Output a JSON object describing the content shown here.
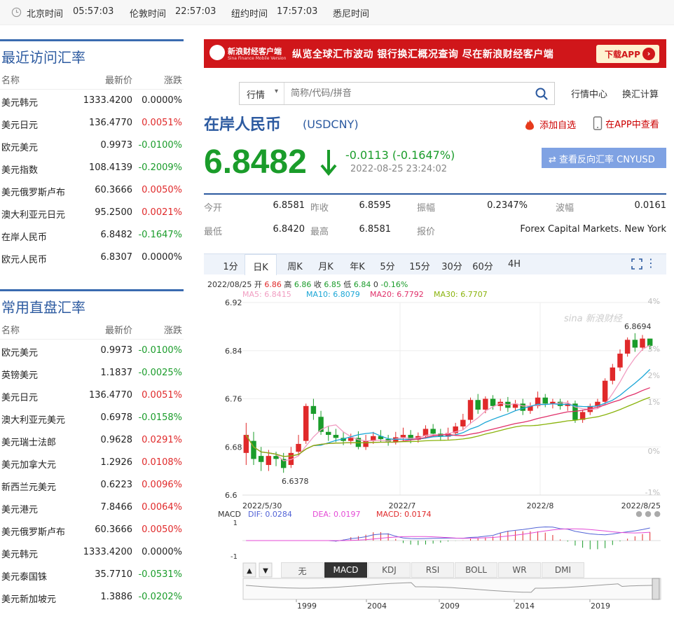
{
  "topbar": {
    "times": [
      {
        "city": "北京时间",
        "time": "05:57:03"
      },
      {
        "city": "伦敦时间",
        "time": "22:57:03"
      },
      {
        "city": "纽约时间",
        "time": "17:57:03"
      },
      {
        "city": "悉尼时间",
        "time": ""
      }
    ]
  },
  "recent": {
    "title": "最近访问汇率",
    "headers": {
      "name": "名称",
      "price": "最新价",
      "change": "涨跌"
    },
    "rows": [
      {
        "name": "美元韩元",
        "price": "1333.4200",
        "change": "0.0000%",
        "dir": "flat"
      },
      {
        "name": "美元日元",
        "price": "136.4770",
        "change": "0.0051%",
        "dir": "up"
      },
      {
        "name": "欧元美元",
        "price": "0.9973",
        "change": "-0.0100%",
        "dir": "down"
      },
      {
        "name": "美元指数",
        "price": "108.4139",
        "change": "-0.2009%",
        "dir": "down"
      },
      {
        "name": "美元俄罗斯卢布",
        "price": "60.3666",
        "change": "0.0050%",
        "dir": "up"
      },
      {
        "name": "澳大利亚元日元",
        "price": "95.2500",
        "change": "0.0021%",
        "dir": "up"
      },
      {
        "name": "在岸人民币",
        "price": "6.8482",
        "change": "-0.1647%",
        "dir": "down"
      },
      {
        "name": "欧元人民币",
        "price": "6.8307",
        "change": "0.0000%",
        "dir": "flat"
      }
    ]
  },
  "direct": {
    "title": "常用直盘汇率",
    "headers": {
      "name": "名称",
      "price": "最新价",
      "change": "涨跌"
    },
    "rows": [
      {
        "name": "欧元美元",
        "price": "0.9973",
        "change": "-0.0100%",
        "dir": "down"
      },
      {
        "name": "英镑美元",
        "price": "1.1837",
        "change": "-0.0025%",
        "dir": "down"
      },
      {
        "name": "美元日元",
        "price": "136.4770",
        "change": "0.0051%",
        "dir": "up"
      },
      {
        "name": "澳大利亚元美元",
        "price": "0.6978",
        "change": "-0.0158%",
        "dir": "down"
      },
      {
        "name": "美元瑞士法郎",
        "price": "0.9628",
        "change": "0.0291%",
        "dir": "up"
      },
      {
        "name": "美元加拿大元",
        "price": "1.2926",
        "change": "0.0108%",
        "dir": "up"
      },
      {
        "name": "新西兰元美元",
        "price": "0.6223",
        "change": "0.0096%",
        "dir": "up"
      },
      {
        "name": "美元港元",
        "price": "7.8466",
        "change": "0.0064%",
        "dir": "up"
      },
      {
        "name": "美元俄罗斯卢布",
        "price": "60.3666",
        "change": "0.0050%",
        "dir": "up"
      },
      {
        "name": "美元韩元",
        "price": "1333.4200",
        "change": "0.0000%",
        "dir": "flat"
      },
      {
        "name": "美元泰国铢",
        "price": "35.7710",
        "change": "-0.0531%",
        "dir": "down"
      },
      {
        "name": "美元新加坡元",
        "price": "1.3886",
        "change": "-0.0202%",
        "dir": "down"
      }
    ]
  },
  "banner": {
    "logo_title": "新浪财经客户端",
    "logo_sub": "Sina Finance Mobile Version",
    "slogan": "纵览全球汇市波动  银行换汇概况查询  尽在新浪财经客户端",
    "download": "下载APP"
  },
  "search": {
    "dropdown": "行情",
    "placeholder": "简称/代码/拼音",
    "link1": "行情中心",
    "link2": "换汇计算"
  },
  "quote": {
    "name": "在岸人民币",
    "code": "(USDCNY)",
    "add_fav": "添加自选",
    "app_view": "在APP中查看",
    "price": "6.8482",
    "change": "-0.0113 (-0.1647%)",
    "time": "2022-08-25 23:24:02",
    "reverse": "查看反向汇率 CNYUSD"
  },
  "stats": {
    "open_label": "今开",
    "open": "6.8581",
    "prev_label": "昨收",
    "prev": "6.8595",
    "amp_label": "振幅",
    "amp": "0.2347%",
    "wave_label": "波幅",
    "wave": "0.0161",
    "low_label": "最低",
    "low": "6.8420",
    "high_label": "最高",
    "high": "6.8581",
    "quote_label": "报价",
    "quote_src": "Forex Capital Markets. New York"
  },
  "chart_tabs": [
    "1分",
    "日K",
    "周K",
    "月K",
    "年K",
    "5分",
    "15分",
    "30分",
    "60分",
    "4H"
  ],
  "chart_tab_active": "日K",
  "kline_info": {
    "date": "2022/08/25",
    "open_label": "开",
    "open": "6.86",
    "high_label": "高",
    "high": "6.86",
    "close_label": "收",
    "close": "6.85",
    "low_label": "低",
    "low": "6.84",
    "vol": "0",
    "pct": "-0.16%"
  },
  "ma_info": {
    "ma5": "MA5: 6.8415",
    "ma10": "MA10: 6.8079",
    "ma20": "MA20: 6.7792",
    "ma30": "MA30: 6.7707"
  },
  "watermark": "sina 新浪财经",
  "macd_info": {
    "label": "MACD",
    "dif": "DIF: 0.0284",
    "dea": "DEA: 0.0197",
    "macd": "MACD: 0.0174"
  },
  "indicator_tabs": [
    "无",
    "MACD",
    "KDJ",
    "RSI",
    "BOLL",
    "WR",
    "DMI"
  ],
  "indicator_active": "MACD",
  "overview_years": [
    "1999",
    "2004",
    "2009",
    "2014",
    "2019"
  ],
  "colors": {
    "up": "#e0292a",
    "down": "#1a9c2a",
    "brand": "#2c5aa0"
  },
  "chart_data": {
    "type": "candlestick",
    "title": "",
    "x_labels": [
      "2022/5/30",
      "2022/7",
      "2022/8",
      "2022/8/25"
    ],
    "y_ticks": [
      "6.92",
      "6.84",
      "6.76",
      "6.68",
      "6.6"
    ],
    "pct_ticks": [
      "4%",
      "3%",
      "2%",
      "1%",
      "0%",
      "-1%"
    ],
    "ylim": [
      6.6,
      6.92
    ],
    "high_label": "6.8694",
    "low_label": "6.6378",
    "macd_ticks": [
      "1",
      "-1"
    ],
    "candles": [
      [
        6.67,
        6.7,
        6.72,
        6.65
      ],
      [
        6.69,
        6.66,
        6.705,
        6.65
      ],
      [
        6.665,
        6.655,
        6.68,
        6.64
      ],
      [
        6.65,
        6.665,
        6.675,
        6.64
      ],
      [
        6.665,
        6.66,
        6.672,
        6.648
      ],
      [
        6.66,
        6.645,
        6.67,
        6.637
      ],
      [
        6.65,
        6.67,
        6.68,
        6.645
      ],
      [
        6.672,
        6.685,
        6.7,
        6.665
      ],
      [
        6.69,
        6.748,
        6.752,
        6.685
      ],
      [
        6.748,
        6.735,
        6.76,
        6.725
      ],
      [
        6.73,
        6.705,
        6.74,
        6.7
      ],
      [
        6.705,
        6.7,
        6.715,
        6.69
      ],
      [
        6.7,
        6.695,
        6.71,
        6.688
      ],
      [
        6.695,
        6.69,
        6.705,
        6.683
      ],
      [
        6.69,
        6.695,
        6.702,
        6.684
      ],
      [
        6.695,
        6.68,
        6.706,
        6.676
      ],
      [
        6.68,
        6.69,
        6.7,
        6.675
      ],
      [
        6.69,
        6.698,
        6.705,
        6.685
      ],
      [
        6.698,
        6.693,
        6.708,
        6.688
      ],
      [
        6.693,
        6.689,
        6.7,
        6.682
      ],
      [
        6.689,
        6.696,
        6.705,
        6.684
      ],
      [
        6.696,
        6.7,
        6.712,
        6.69
      ],
      [
        6.7,
        6.692,
        6.708,
        6.686
      ],
      [
        6.692,
        6.698,
        6.704,
        6.687
      ],
      [
        6.698,
        6.71,
        6.716,
        6.694
      ],
      [
        6.71,
        6.702,
        6.718,
        6.697
      ],
      [
        6.702,
        6.697,
        6.71,
        6.69
      ],
      [
        6.697,
        6.703,
        6.712,
        6.692
      ],
      [
        6.703,
        6.714,
        6.72,
        6.699
      ],
      [
        6.714,
        6.725,
        6.735,
        6.708
      ],
      [
        6.725,
        6.758,
        6.762,
        6.718
      ],
      [
        6.758,
        6.742,
        6.768,
        6.735
      ],
      [
        6.742,
        6.76,
        6.764,
        6.736
      ],
      [
        6.76,
        6.748,
        6.766,
        6.742
      ],
      [
        6.748,
        6.755,
        6.76,
        6.74
      ],
      [
        6.755,
        6.745,
        6.763,
        6.738
      ],
      [
        6.745,
        6.752,
        6.758,
        6.74
      ],
      [
        6.752,
        6.74,
        6.76,
        6.733
      ],
      [
        6.74,
        6.748,
        6.754,
        6.735
      ],
      [
        6.748,
        6.762,
        6.772,
        6.744
      ],
      [
        6.762,
        6.752,
        6.768,
        6.746
      ],
      [
        6.752,
        6.755,
        6.76,
        6.744
      ],
      [
        6.755,
        6.748,
        6.76,
        6.742
      ],
      [
        6.748,
        6.752,
        6.757,
        6.74
      ],
      [
        6.752,
        6.725,
        6.757,
        6.72
      ],
      [
        6.725,
        6.738,
        6.742,
        6.72
      ],
      [
        6.738,
        6.748,
        6.752,
        6.733
      ],
      [
        6.748,
        6.755,
        6.76,
        6.744
      ],
      [
        6.755,
        6.79,
        6.794,
        6.75
      ],
      [
        6.79,
        6.812,
        6.818,
        6.784
      ],
      [
        6.812,
        6.835,
        6.842,
        6.806
      ],
      [
        6.835,
        6.858,
        6.862,
        6.83
      ],
      [
        6.858,
        6.845,
        6.869,
        6.838
      ],
      [
        6.845,
        6.86,
        6.866,
        6.84
      ],
      [
        6.86,
        6.848,
        6.86,
        6.842
      ]
    ]
  }
}
